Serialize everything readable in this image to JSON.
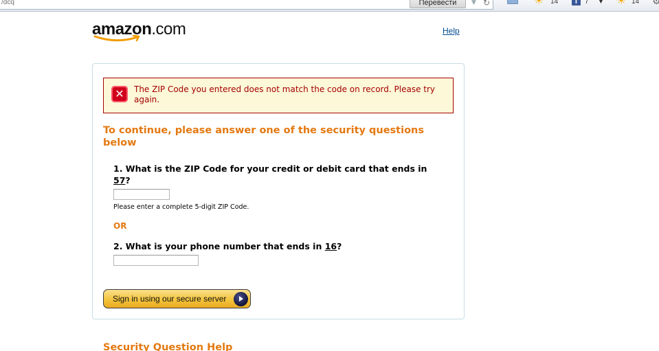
{
  "browser": {
    "url": "/dcq",
    "translate_label": "Перевести",
    "weather_temp_1": "14",
    "facebook_letter": "f",
    "facebook_count": "7",
    "weather_temp_2": "14"
  },
  "header": {
    "logo_brand": "amazon",
    "logo_suffix": ".com",
    "help_label": "Help"
  },
  "error": {
    "message": "The ZIP Code you entered does not match the code on record. Please try again."
  },
  "form": {
    "heading": "To continue, please answer one of the security questions below",
    "q1_prefix": "1. What is the ZIP Code for your credit or debit card that ends in ",
    "q1_digits": "57",
    "q1_suffix": "?",
    "zip_value": "",
    "zip_hint": "Please enter a complete 5-digit ZIP Code.",
    "or_label": "OR",
    "q2_prefix": "2. What is your phone number that ends in ",
    "q2_digits": "16",
    "q2_suffix": "?",
    "phone_value": "",
    "submit_label": "Sign in using our secure server"
  },
  "footer": {
    "section_title": "Security Question Help"
  },
  "colors": {
    "accent_orange": "#e47911",
    "error_red": "#a50000",
    "link_blue": "#004b91",
    "error_bg": "#fcf8d8"
  }
}
